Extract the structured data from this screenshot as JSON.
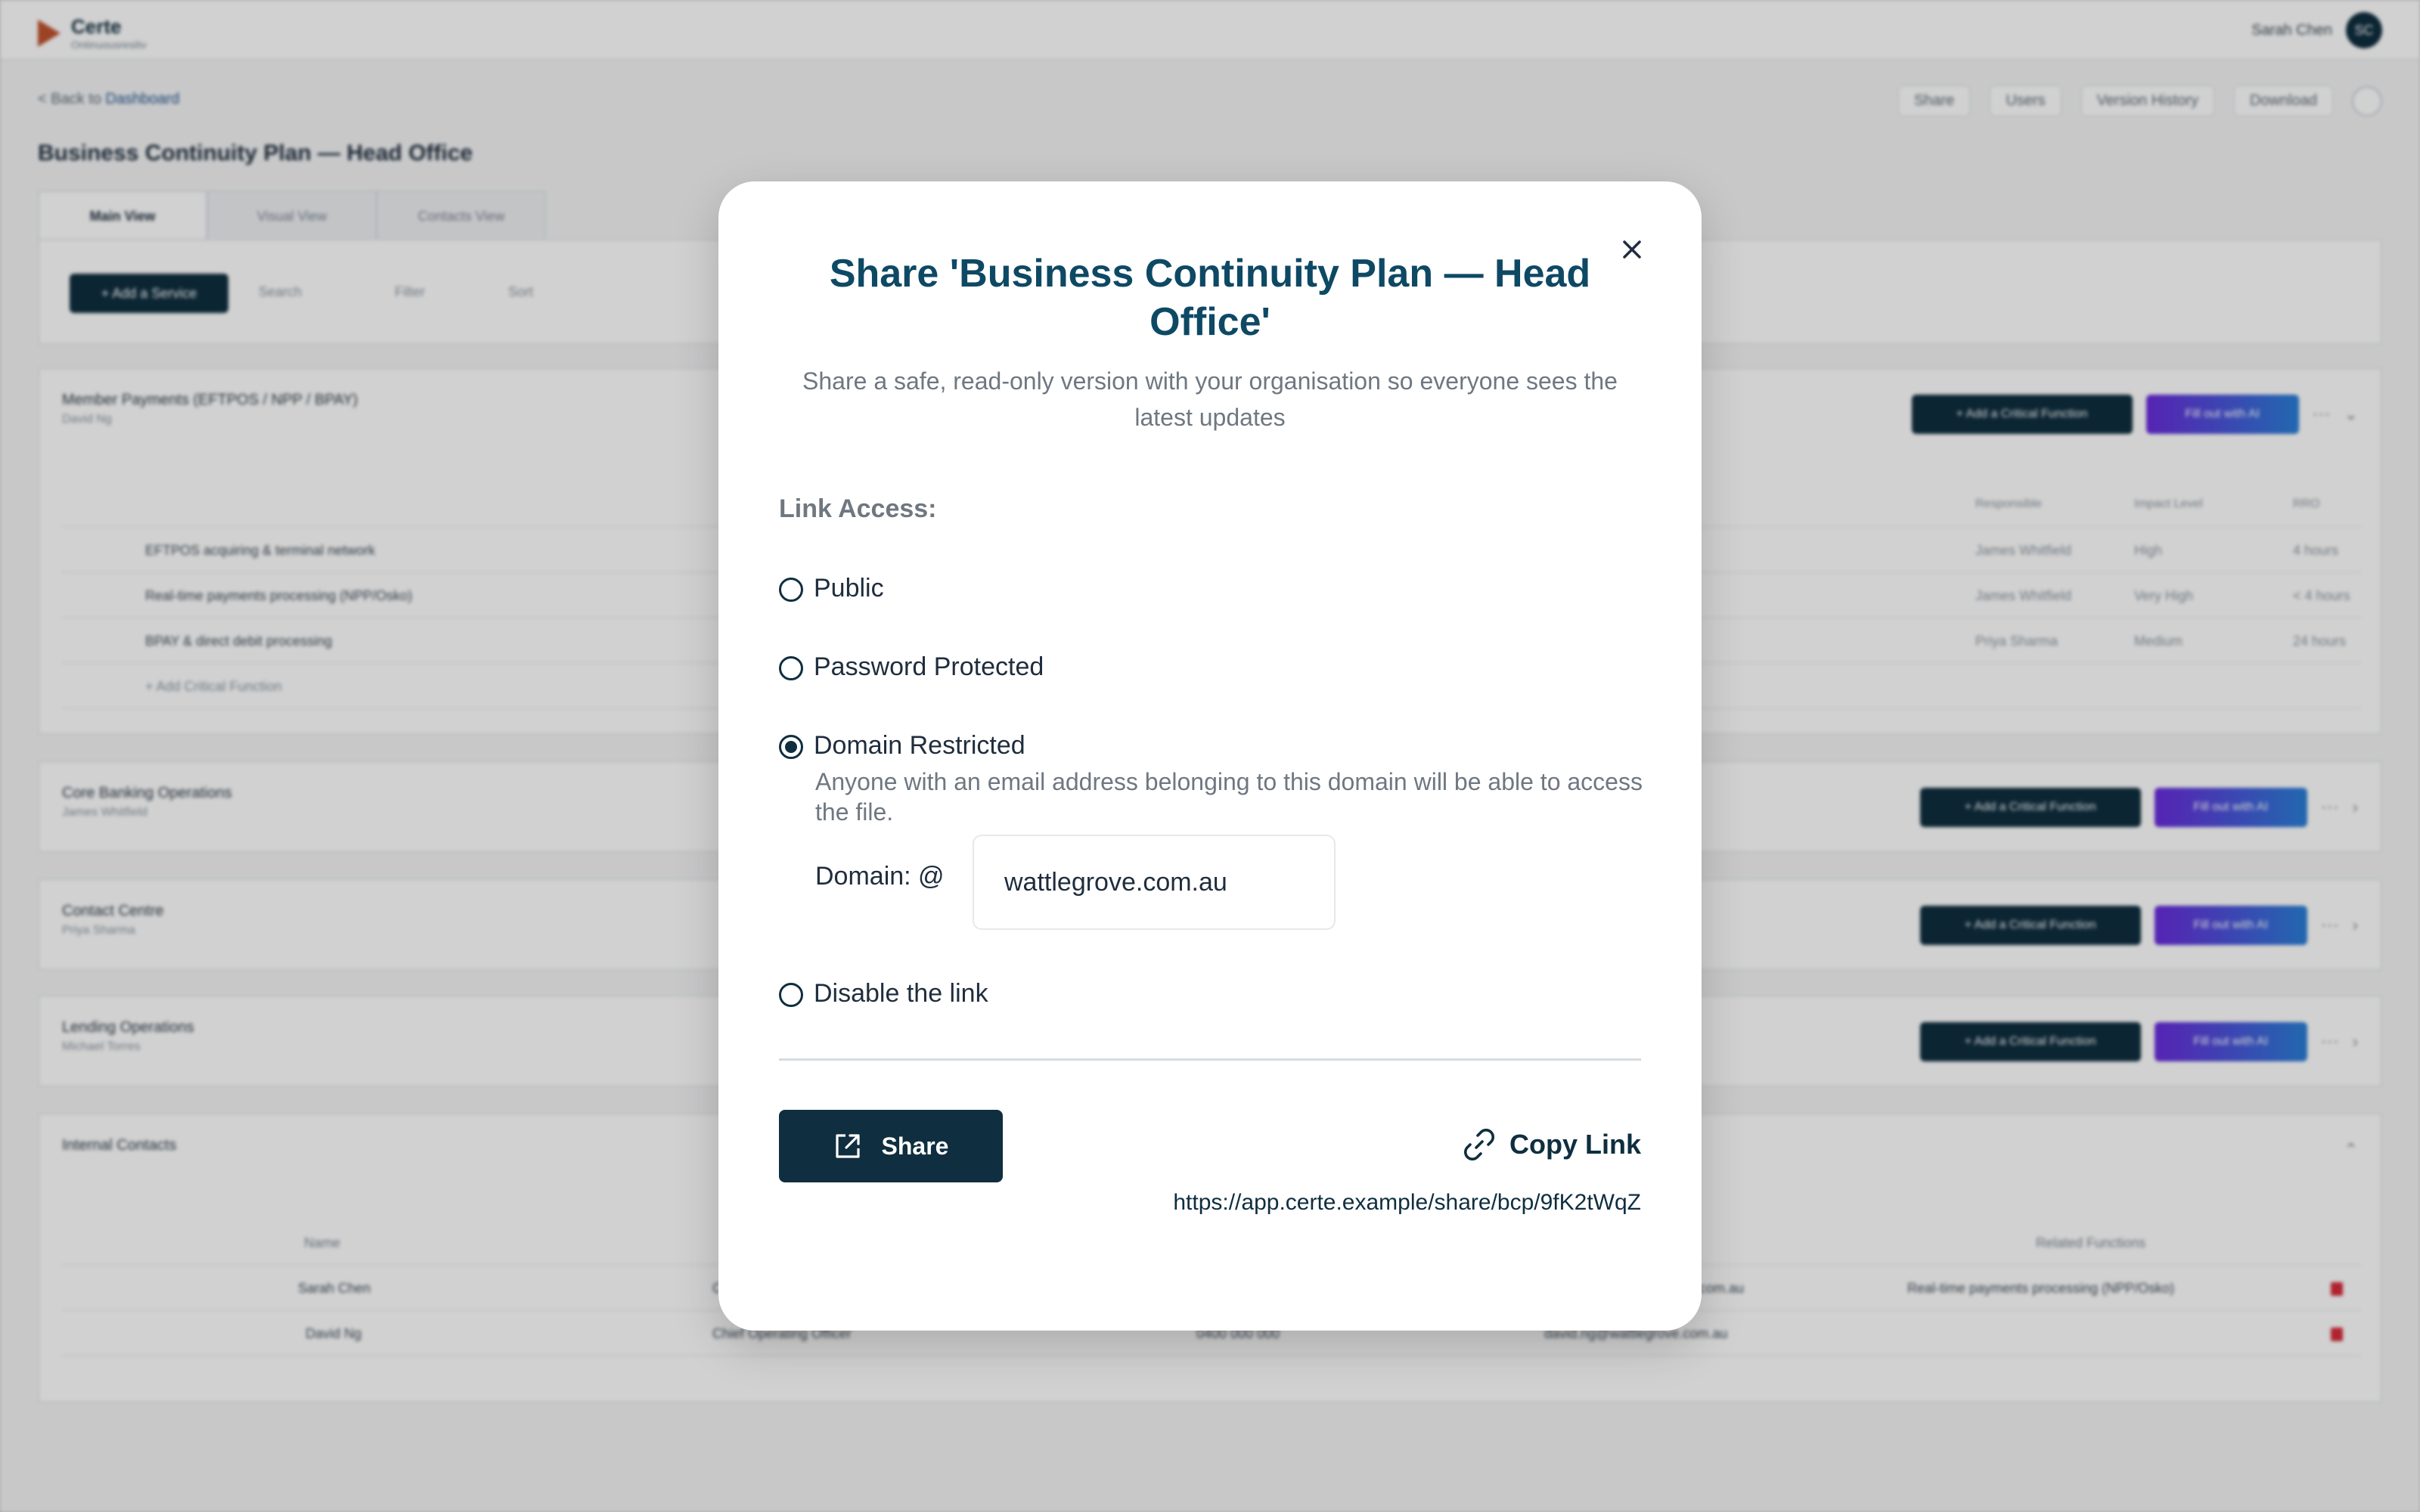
{
  "app": {
    "brand": "Certe",
    "brand_sub": "Ontinuousresiliv",
    "user_name": "Sarah Chen",
    "user_initials": "SC",
    "back_prefix": "< Back to",
    "back_link": "Dashboard",
    "toolbar": [
      "Share",
      "Users",
      "Version History",
      "Download"
    ],
    "document_title": "Business Continuity Plan — Head Office",
    "tabs": [
      "Main View",
      "Visual View",
      "Contacts View"
    ],
    "add_service": "+ Add a Service",
    "search": "Search",
    "filter": "Filter",
    "sort": "Sort",
    "add_critical": "+ Add a Critical Function",
    "fill_ai": "Fill out with AI",
    "card1": {
      "title": "Member Payments (EFTPOS / NPP / BPAY)",
      "owner": "David Ng",
      "headers": [
        "Responsible",
        "Impact Level",
        "RRO"
      ],
      "rows": [
        {
          "name": "EFTPOS acquiring & terminal network",
          "resp": "James Whitfield",
          "impact": "High",
          "rto": "4 hours"
        },
        {
          "name": "Real-time payments processing (NPP/Osko)",
          "resp": "James Whitfield",
          "impact": "Very High",
          "rto": "< 4 hours"
        },
        {
          "name": "BPAY & direct debit processing",
          "resp": "Priya Sharma",
          "impact": "Medium",
          "rto": "24 hours"
        }
      ],
      "add_row": "+ Add Critical Function"
    },
    "card2": {
      "title": "Core Banking Operations",
      "owner": "James Whitfield"
    },
    "card3": {
      "title": "Contact Centre",
      "owner": "Priya Sharma"
    },
    "card4": {
      "title": "Lending Operations",
      "owner": "Michael Torres"
    },
    "contacts": {
      "title": "Internal Contacts",
      "headers": [
        "Name",
        "Related Functions"
      ],
      "rows": [
        {
          "name": "Sarah Chen",
          "role": "C",
          "email": "...com.au",
          "related": "Real-time payments processing (NPP/Osko)"
        },
        {
          "name": "David Ng",
          "role": "Chief Operating Officer",
          "phone": "0400 000 000",
          "email": "david.ng@wattlegrove.com.au",
          "related": ""
        }
      ]
    }
  },
  "modal": {
    "title": "Share 'Business Continuity Plan — Head Office'",
    "subtitle": "Share a safe, read-only version with your organisation so everyone sees the latest updates",
    "section_label": "Link Access:",
    "options": {
      "public": "Public",
      "password": "Password Protected",
      "domain": "Domain Restricted",
      "disable": "Disable the link"
    },
    "selected": "domain",
    "domain_desc": "Anyone with an email address belonging to this domain will be able to access the file.",
    "domain_label": "Domain: @",
    "domain_value": "wattlegrove.com.au",
    "share_button": "Share",
    "copy_link": "Copy Link",
    "share_url": "https://app.certe.example/share/bcp/9fK2tWqZ"
  }
}
